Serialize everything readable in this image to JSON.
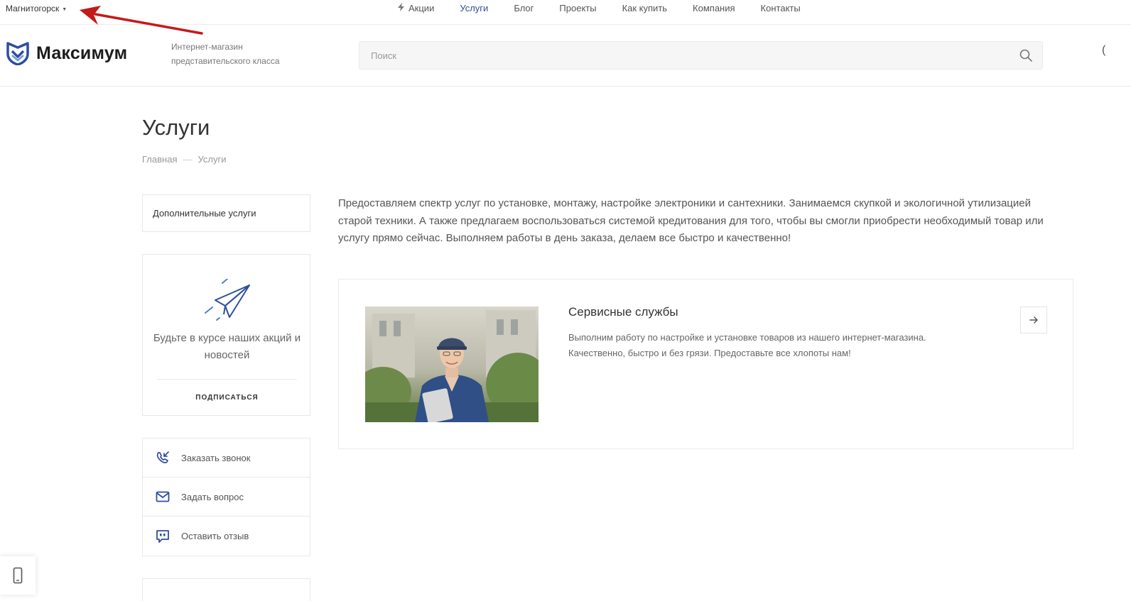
{
  "topbar": {
    "city": "Магнитогорск",
    "nav": [
      {
        "label": "Акции",
        "active": false,
        "icon": "bolt-icon"
      },
      {
        "label": "Услуги",
        "active": true
      },
      {
        "label": "Блог",
        "active": false
      },
      {
        "label": "Проекты",
        "active": false
      },
      {
        "label": "Как купить",
        "active": false
      },
      {
        "label": "Компания",
        "active": false
      },
      {
        "label": "Контакты",
        "active": false
      }
    ]
  },
  "header": {
    "logo_name": "Максимум",
    "tagline": "Интернет-магазин представительского класса",
    "search_placeholder": "Поиск",
    "edge_glyph": "("
  },
  "page": {
    "title": "Услуги",
    "breadcrumb": [
      {
        "label": "Главная"
      },
      {
        "label": "Услуги"
      }
    ],
    "breadcrumb_sep": "—"
  },
  "sidebar": {
    "menu_item": "Дополнительные услуги",
    "subscribe_text": "Будьте в курсе наших акций и новостей",
    "subscribe_button": "ПОДПИСАТЬСЯ",
    "actions": [
      {
        "label": "Заказать звонок",
        "icon": "phone-callback-icon"
      },
      {
        "label": "Задать вопрос",
        "icon": "envelope-icon"
      },
      {
        "label": "Оставить отзыв",
        "icon": "chat-quote-icon"
      }
    ]
  },
  "main": {
    "intro": "Предоставляем спектр услуг по установке, монтажу, настройке электроники и сантехники. Занимаемся скупкой и экологичной утилизацией старой техники. А также предлагаем воспользоваться системой кредитования для того, чтобы вы смогли приобрести необходимый товар или услугу прямо сейчас. Выполняем работы в день заказа, делаем все быстро и качественно!",
    "card": {
      "title": "Сервисные службы",
      "description": "Выполним работу по настройке и установке товаров из нашего интернет-магазина. Качественно, быстро и без грязи. Предоставьте все хлопоты нам!"
    }
  },
  "colors": {
    "accent": "#2e4e9e",
    "annotation": "#c41a1a"
  }
}
